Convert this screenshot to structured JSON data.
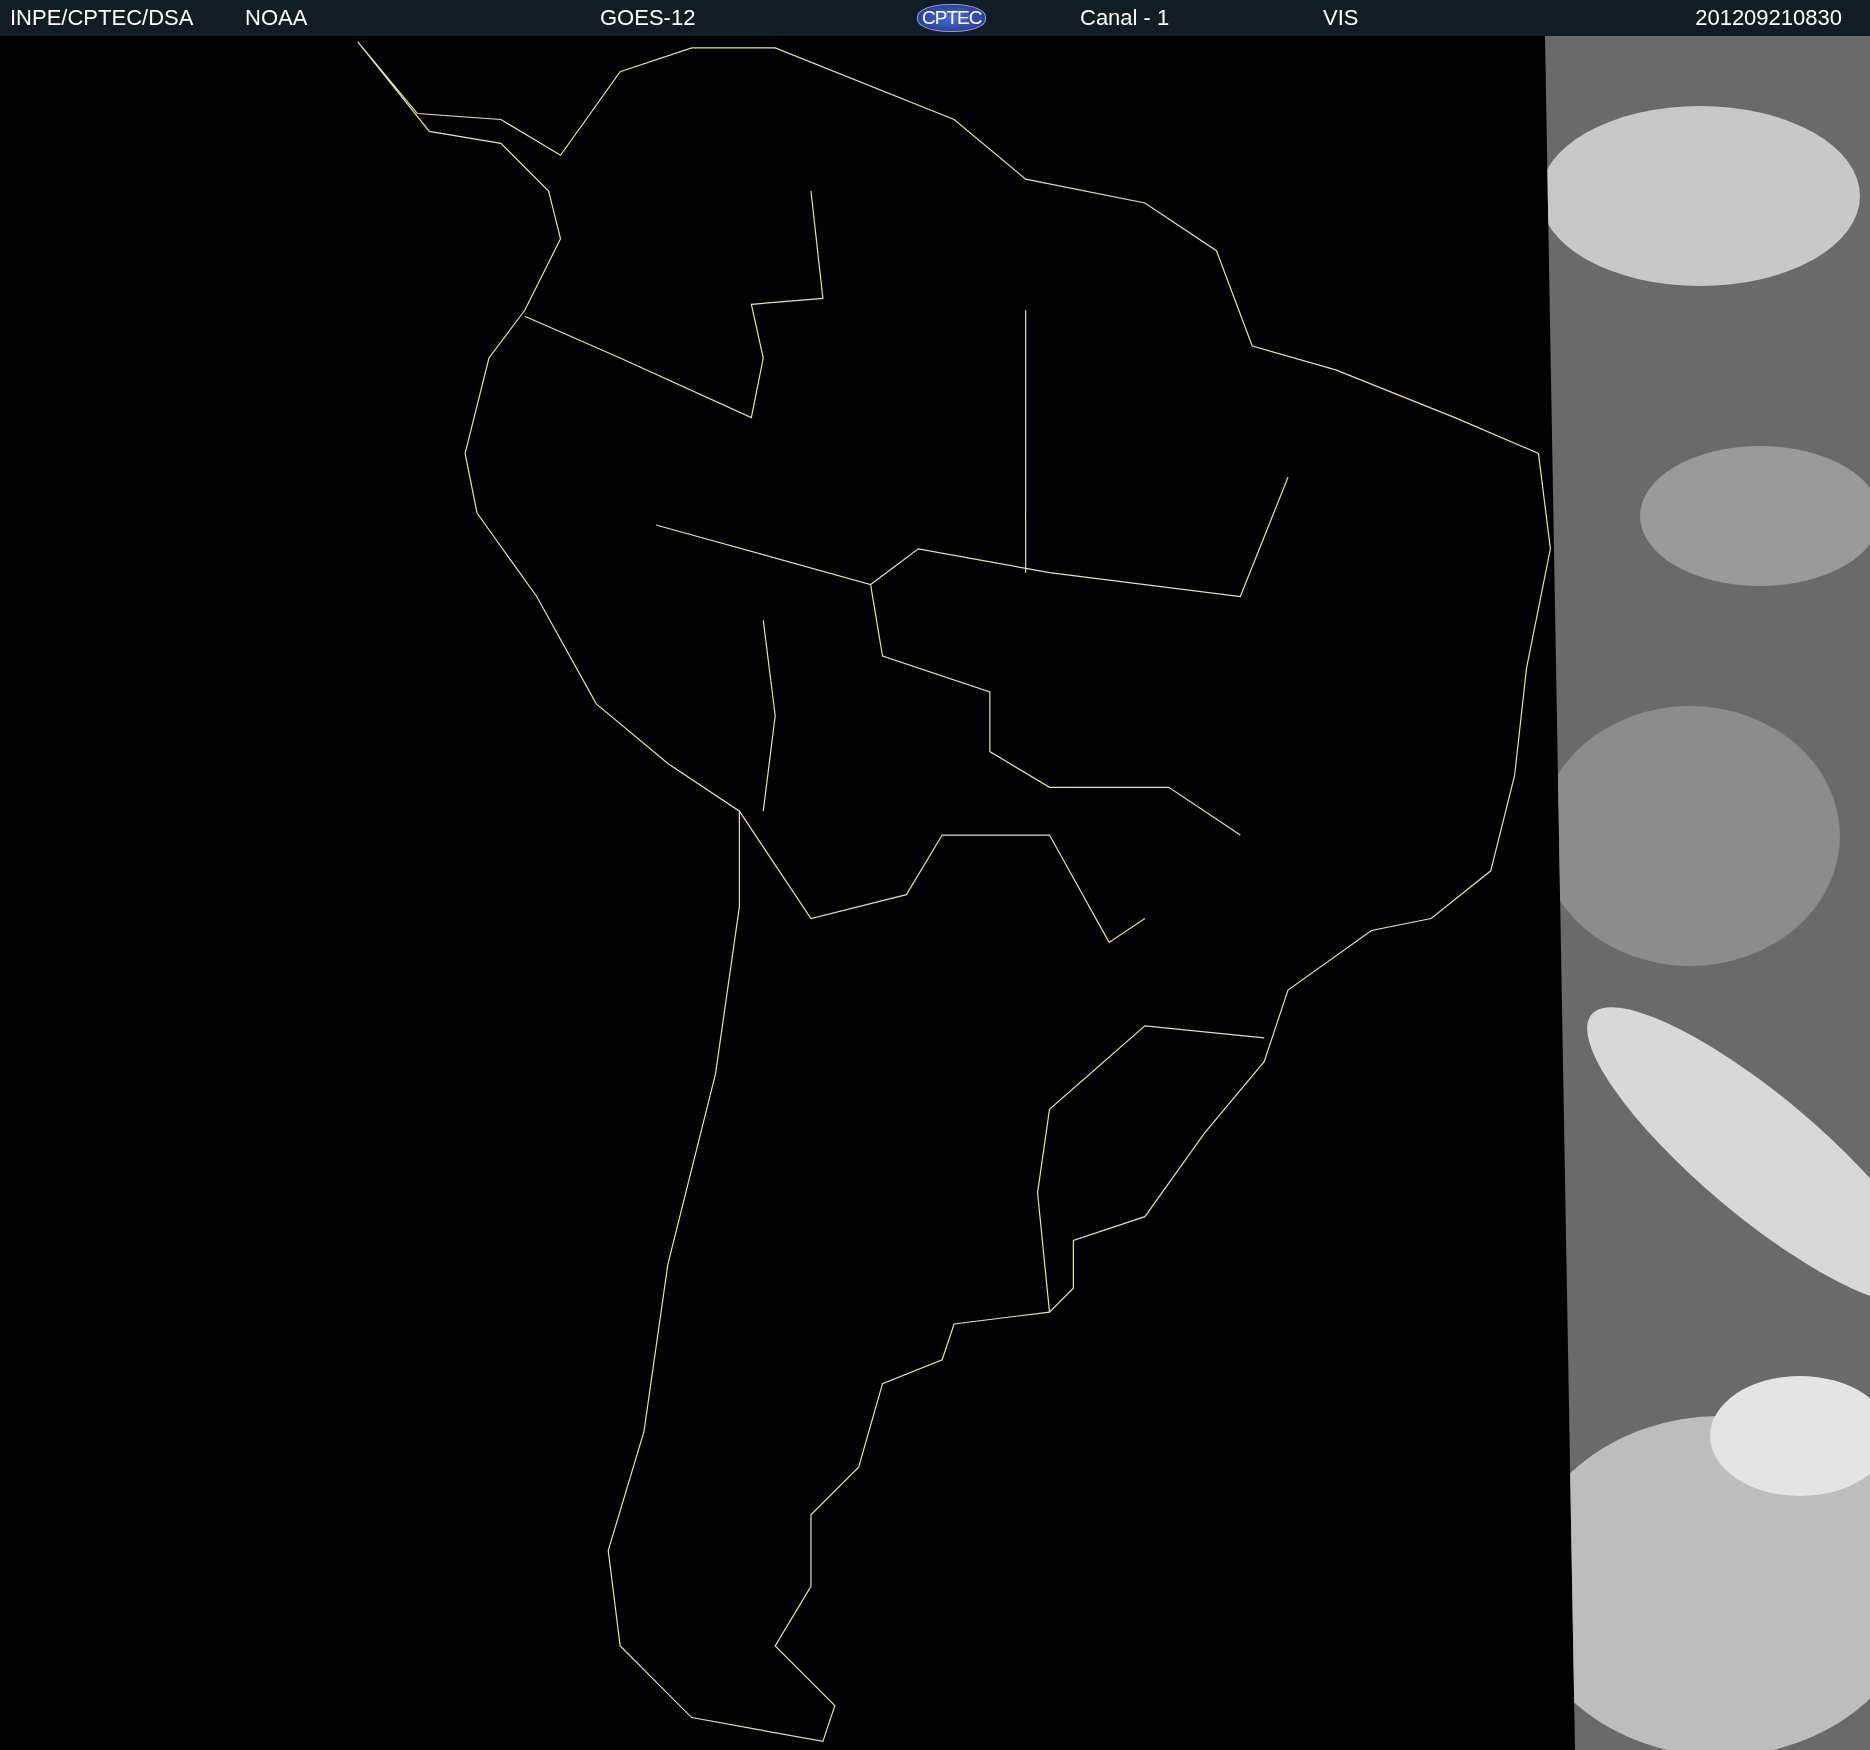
{
  "header": {
    "source": "INPE/CPTEC/DSA",
    "agency": "NOAA",
    "satellite": "GOES-12",
    "logo": "CPTEC",
    "channel": "Canal - 1",
    "band": "VIS",
    "timestamp": "201209210830"
  }
}
